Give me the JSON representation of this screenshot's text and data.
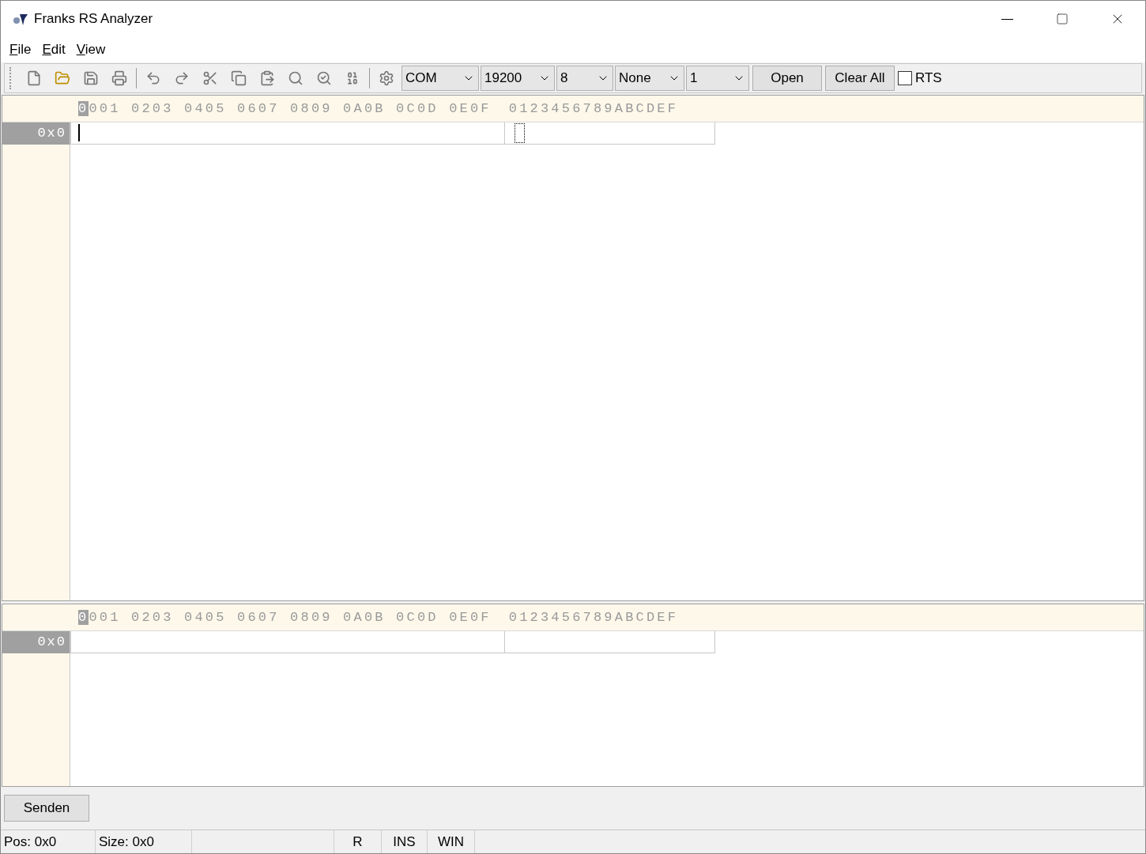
{
  "window": {
    "title": "Franks RS Analyzer"
  },
  "menu": [
    {
      "label": "File",
      "mnemonic": true
    },
    {
      "label": "Edit",
      "mnemonic": true
    },
    {
      "label": "View",
      "mnemonic": true
    }
  ],
  "toolbar": {
    "dropdowns": [
      {
        "value": "COM"
      },
      {
        "value": "19200"
      },
      {
        "value": "8"
      },
      {
        "value": "None"
      },
      {
        "value": "1"
      }
    ],
    "buttons": [
      "Open",
      "Clear All"
    ],
    "rts": {
      "label": "RTS",
      "checked": false
    }
  },
  "panes": [
    {
      "header_groups": [
        "0001",
        "0203",
        "0405",
        "0607",
        "0809",
        "0A0B",
        "0C0D",
        "0E0F"
      ],
      "ascii_header": "0123456789ABCDEF",
      "cursor_marked": true,
      "rows": [
        {
          "offset": "0x0",
          "caret": true
        }
      ]
    },
    {
      "header_groups": [
        "0001",
        "0203",
        "0405",
        "0607",
        "0809",
        "0A0B",
        "0C0D",
        "0E0F"
      ],
      "ascii_header": "0123456789ABCDEF",
      "cursor_marked": true,
      "rows": [
        {
          "offset": "0x0",
          "caret": false
        }
      ]
    }
  ],
  "send_button": "Senden",
  "status_bar": [
    "Pos: 0x0",
    "Size: 0x0",
    "R",
    "INS",
    "WIN"
  ]
}
